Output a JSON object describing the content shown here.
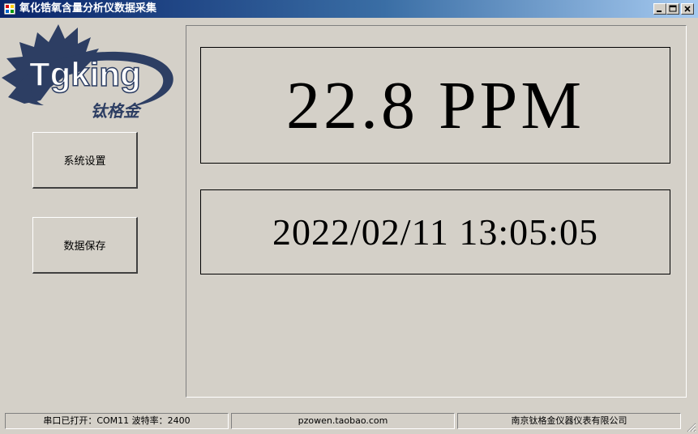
{
  "window": {
    "title": "氧化锆氧含量分析仪数据采集"
  },
  "logo": {
    "wordmark": "Tgking",
    "chinese": "钛格金"
  },
  "buttons": {
    "settings": "系统设置",
    "save": "数据保存"
  },
  "display": {
    "reading": "22.8 PPM",
    "datetime": "2022/02/11 13:05:05"
  },
  "status": {
    "port": "串口已打开：COM11  波特率：2400",
    "website": "pzowen.taobao.com",
    "company": "南京钛格金仪器仪表有限公司"
  },
  "colors": {
    "background": "#d4d0c8",
    "title_gradient_start": "#0a246a",
    "title_gradient_end": "#a6caf0",
    "logo_navy": "#2d3e63"
  }
}
